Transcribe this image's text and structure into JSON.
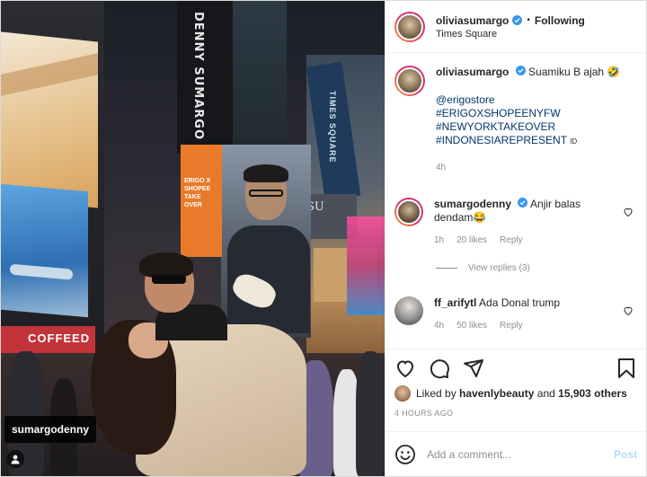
{
  "photo": {
    "tower_sign": "DENNY SUMARGO",
    "times_square_sign": "TIMES SQUARE",
    "orange_sign": "ERIGO X SHOPEE TAKE OVER",
    "su_sign": "SU",
    "coffee_sign": "COFFEED",
    "user_tag": "sumargodenny"
  },
  "header": {
    "username": "oliviasumargo",
    "separator": "•",
    "follow_state": "Following",
    "location": "Times Square"
  },
  "caption": {
    "username": "oliviasumargo",
    "text": "Suamiku B ajah 🤣",
    "lines": [
      "@erigostore",
      "#ERIGOXSHOPEENYFW",
      "#NEWYORKTAKEOVER",
      "#INDONESIAREPRESENT"
    ],
    "suffix": "ID",
    "time": "4h"
  },
  "comments": [
    {
      "username": "sumargodenny",
      "text": "Anjir balas dendam😂",
      "time": "1h",
      "likes": "20 likes",
      "reply": "Reply",
      "view_replies": "View replies (3)"
    },
    {
      "username": "ff_arifytl",
      "text": "Ada Donal trump",
      "time": "4h",
      "likes": "50 likes",
      "reply": "Reply"
    }
  ],
  "likes": {
    "prefix": "Liked by",
    "user": "havenlybeauty",
    "and": "and",
    "count": "15,903 others"
  },
  "posted": "4 HOURS AGO",
  "add_comment": {
    "placeholder": "Add a comment...",
    "post_label": "Post"
  },
  "colors": {
    "link": "#00376b",
    "verified": "#3897f0",
    "muted": "#8e8e8e",
    "post_disabled": "#b2dffc"
  },
  "icons": [
    "heart-icon",
    "comment-icon",
    "share-icon",
    "save-icon",
    "emoji-icon",
    "verified-icon",
    "person-icon"
  ]
}
